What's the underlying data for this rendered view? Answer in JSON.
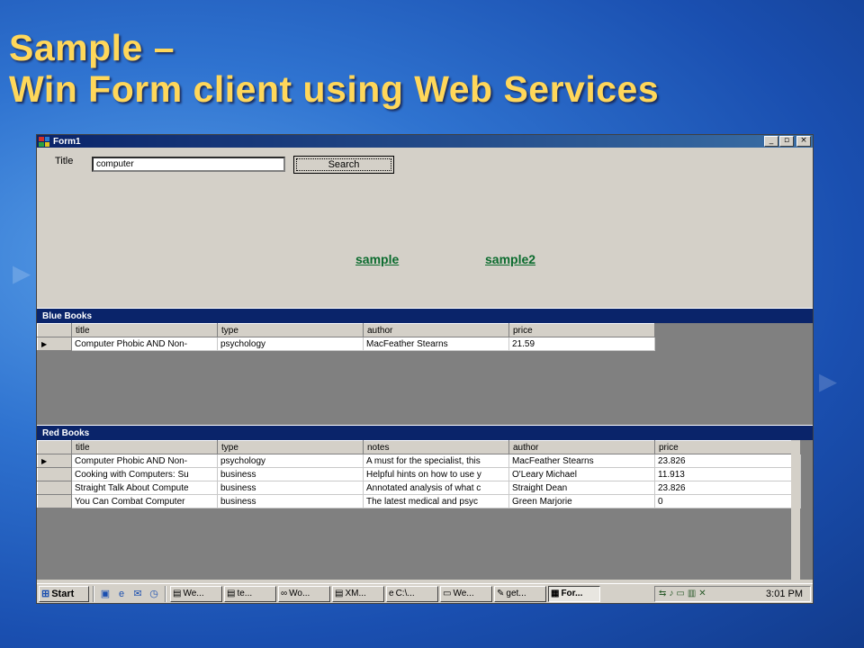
{
  "slide": {
    "title_line1": "Sample –",
    "title_line2": "Win Form client using Web Services",
    "title_color": "#ffd75a"
  },
  "window": {
    "title": "Form1",
    "minimize": "_",
    "maximize": "▫",
    "close": "×"
  },
  "search": {
    "label": "Title",
    "value": "computer",
    "button": "Search"
  },
  "links": {
    "sample": "sample",
    "sample2": "sample2",
    "color": "#0b6b2e"
  },
  "blue_books": {
    "header": "Blue Books",
    "columns": [
      "title",
      "type",
      "author",
      "price"
    ],
    "rows": [
      [
        "Computer Phobic AND Non-",
        "psychology",
        "MacFeather Stearns",
        "21.59"
      ]
    ]
  },
  "red_books": {
    "header": "Red Books",
    "columns": [
      "title",
      "type",
      "notes",
      "author",
      "price"
    ],
    "rows": [
      [
        "Computer Phobic AND Non-",
        "psychology",
        "A must for the specialist, this",
        "MacFeather Stearns",
        "23.826"
      ],
      [
        "Cooking with Computers: Su",
        "business",
        "Helpful hints on how to use y",
        "O'Leary Michael",
        "11.913"
      ],
      [
        "Straight Talk About Compute",
        "business",
        "Annotated analysis of what c",
        "Straight Dean",
        "23.826"
      ],
      [
        "You Can Combat Computer",
        "business",
        "The latest medical and psyc",
        "Green Marjorie",
        "0"
      ]
    ]
  },
  "taskbar": {
    "start": "Start",
    "tasks": [
      "We...",
      "te...",
      "Wo...",
      "XM...",
      "C:\\...",
      "We...",
      "get...",
      "For..."
    ],
    "active_index": 7,
    "clock": "3:01 PM"
  }
}
